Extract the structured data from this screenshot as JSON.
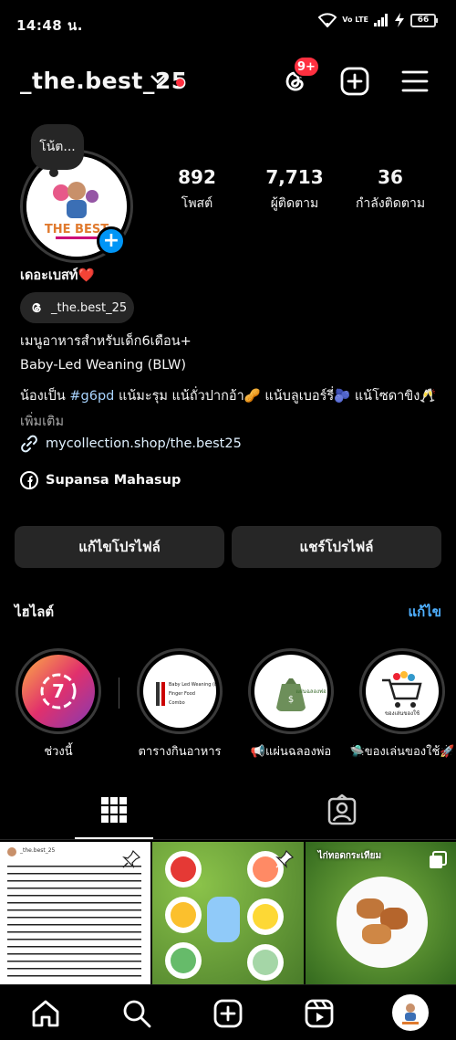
{
  "status_bar": {
    "time": "14:48 น.",
    "network": "Vo LTE",
    "battery": "66"
  },
  "header": {
    "username": "_the.best_25",
    "notification_badge": "9+"
  },
  "profile": {
    "note": "โน้ต...",
    "avatar_text": "THE BEST",
    "stats": [
      {
        "value": "892",
        "label": "โพสต์"
      },
      {
        "value": "7,713",
        "label": "ผู้ติดตาม"
      },
      {
        "value": "36",
        "label": "กำลังติดตาม"
      }
    ],
    "display_name": "เดอะเบสท์❤️",
    "threads_handle": "_the.best_25",
    "bio_line1": "เมนูอาหารสำหรับเด็ก6เดือน+",
    "bio_line2": "Baby-Led Weaning (BLW)",
    "bio_line3_prefix": "น้องเป็น ",
    "bio_hashtag": "#g6pd",
    "bio_line3_suffix": " แน้มะรุม แน้ถั่วปากอ้า🥜 แน้บลูเบอร์รี่🫐 แน้โซดาขิง🥂",
    "more": "เพิ่มเติม",
    "link": "mycollection.shop/the.best25",
    "facebook_name": "Supansa Mahasup"
  },
  "buttons": {
    "edit_profile": "แก้ไขโปรไฟล์",
    "share_profile": "แชร์โปรไฟล์"
  },
  "highlights": {
    "title": "ไฮไลต์",
    "edit": "แก้ไข",
    "items": [
      {
        "label": "ช่วงนี้",
        "badge": "7"
      },
      {
        "label": "ตารางกินอาหาร",
        "cover_text": "Baby Led Weaning (BLW) Finger Food Combo"
      },
      {
        "label": "📢แผ่นฉลองพ่อ",
        "cover_text": "แผ่นฉลองพ่อ"
      },
      {
        "label": "🛸ของเล่นของใช้🚀",
        "cover_text": "ของเล่นของใช้"
      }
    ]
  },
  "grid_posts": [
    {
      "caption": "_the.best_25"
    },
    {
      "caption": ""
    },
    {
      "caption": "ไก่ทอดกระเทียม"
    }
  ],
  "colors": {
    "accent": "#0095f6",
    "badge": "#ff3040",
    "link": "#4fb0ff",
    "surface": "#262626"
  }
}
